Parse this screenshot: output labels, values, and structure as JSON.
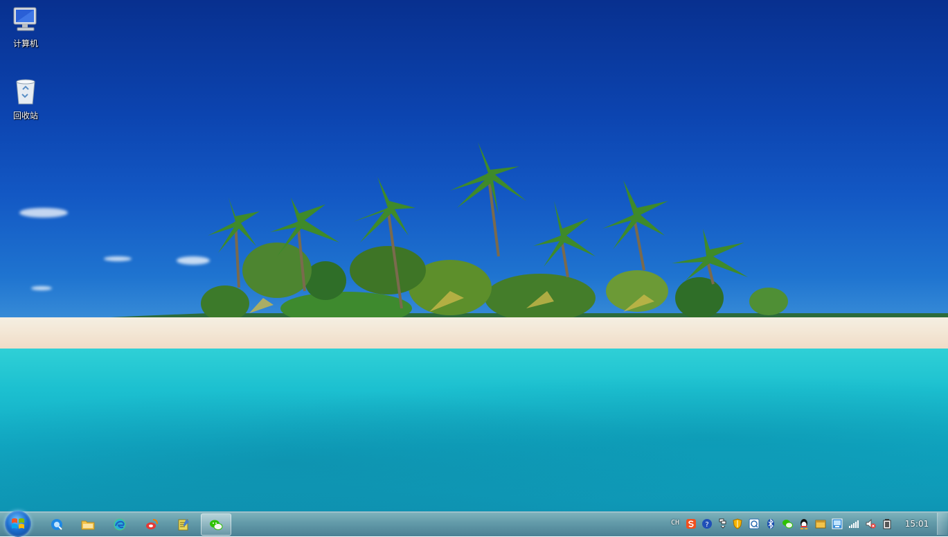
{
  "desktop": {
    "icons": [
      {
        "label": "计算机",
        "icon": "computer-icon"
      },
      {
        "label": "回收站",
        "icon": "recycle-bin-icon"
      }
    ]
  },
  "taskbar": {
    "pinned": [
      {
        "name": "qq-browser-icon",
        "color": "#1e88e5"
      },
      {
        "name": "file-explorer-icon",
        "color": "#f3c34a"
      },
      {
        "name": "edge-icon",
        "color": "#2ab0d8"
      },
      {
        "name": "weibo-icon",
        "color": "#e53935"
      },
      {
        "name": "notepad-icon",
        "color": "#e8d85a"
      },
      {
        "name": "wechat-icon",
        "color": "#2dc100"
      }
    ],
    "active_app": "wechat-icon",
    "tray": {
      "language": "CH",
      "icons": [
        "sogou-input-icon",
        "help-icon",
        "network-adapter-icon",
        "security-shield-icon",
        "feedback-icon",
        "bluetooth-icon",
        "wechat-tray-icon",
        "qq-tray-icon",
        "folder-tray-icon",
        "display-icon",
        "signal-icon",
        "volume-muted-icon",
        "battery-icon"
      ],
      "time": "15:01"
    }
  },
  "colors": {
    "sky_top": "#08308f",
    "sea": "#1cc0d0",
    "sand": "#f3e6d4",
    "taskbar": "#5c96a5"
  }
}
